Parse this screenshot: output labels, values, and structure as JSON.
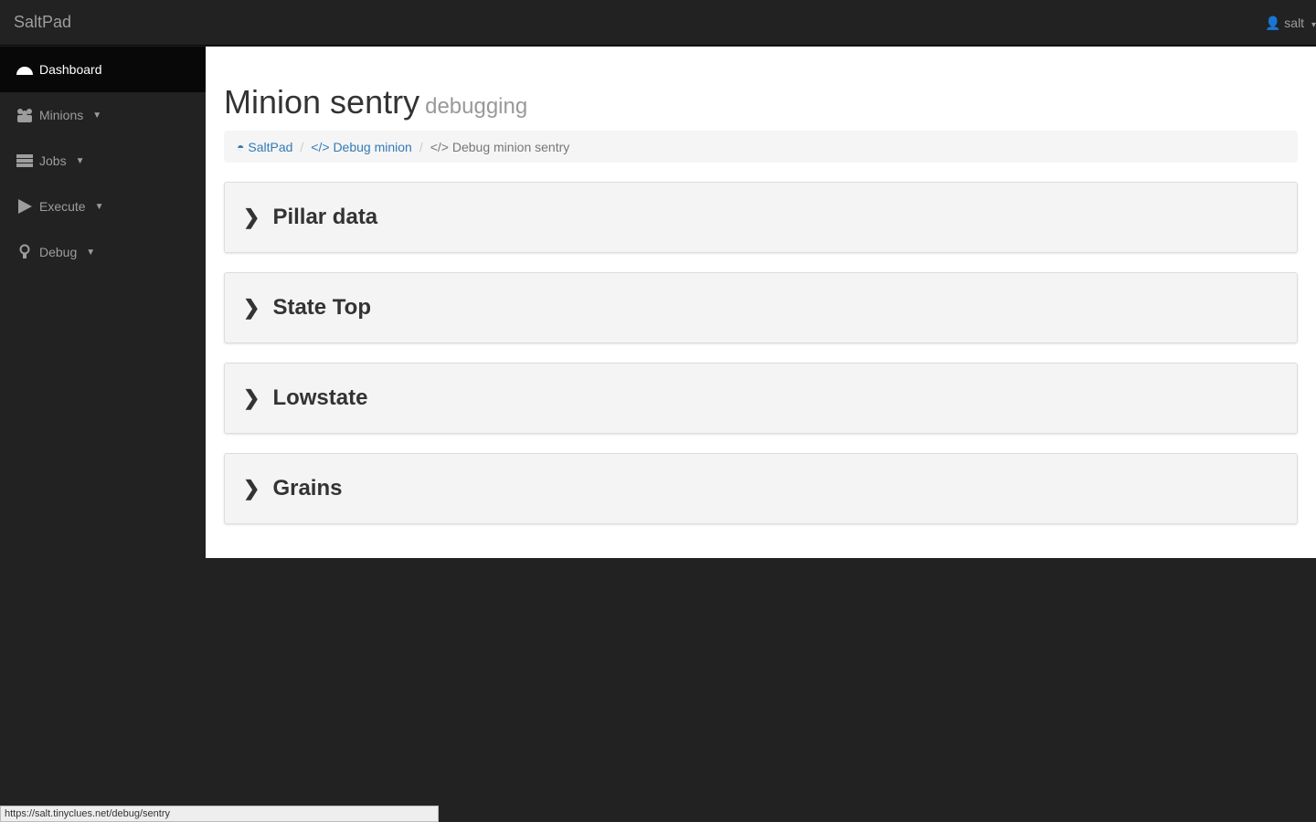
{
  "app": {
    "brand": "SaltPad",
    "user": "salt"
  },
  "sidebar": {
    "items": [
      {
        "label": "Dashboard",
        "icon": "dashboard-icon"
      },
      {
        "label": "Minions",
        "icon": "users-icon"
      },
      {
        "label": "Jobs",
        "icon": "tasks-icon"
      },
      {
        "label": "Execute",
        "icon": "play-icon"
      },
      {
        "label": "Debug",
        "icon": "lightbulb-icon"
      }
    ]
  },
  "page": {
    "title": "Minion sentry",
    "subtitle": "debugging"
  },
  "breadcrumb": [
    "SaltPad",
    "Debug minion",
    "Debug minion sentry"
  ],
  "panels": [
    "Pillar data",
    "State Top",
    "Lowstate",
    "Grains"
  ],
  "status_url": "https://salt.tinyclues.net/debug/sentry"
}
